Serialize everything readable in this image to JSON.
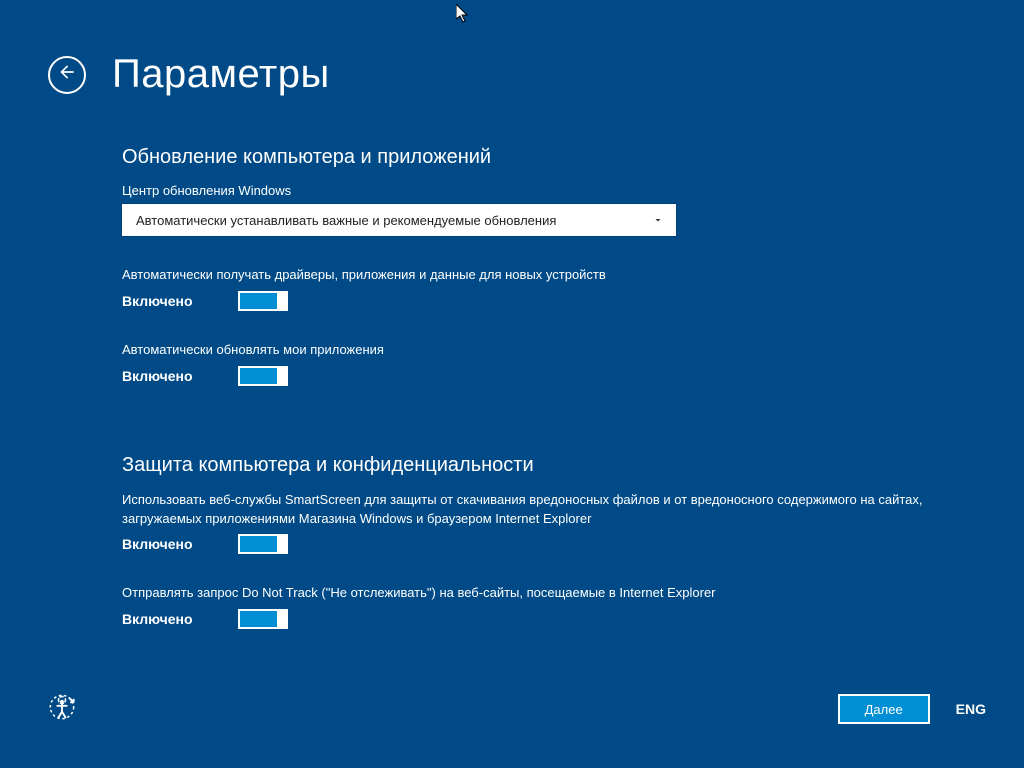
{
  "title": "Параметры",
  "section1": {
    "heading": "Обновление компьютера и приложений",
    "wu_label": "Центр обновления Windows",
    "wu_selected": "Автоматически устанавливать важные и рекомендуемые обновления",
    "opt1_desc": "Автоматически получать драйверы, приложения и данные для новых устройств",
    "opt1_state": "Включено",
    "opt2_desc": "Автоматически обновлять мои приложения",
    "opt2_state": "Включено"
  },
  "section2": {
    "heading": "Защита компьютера и конфиденциальности",
    "opt1_desc": "Использовать веб-службы SmartScreen для защиты от скачивания вредоносных файлов и от вредоносного содержимого на сайтах, загружаемых приложениями Магазина Windows и браузером Internet Explorer",
    "opt1_state": "Включено",
    "opt2_desc": "Отправлять запрос Do Not Track (\"Не отслеживать\") на веб-сайты, посещаемые в Internet Explorer",
    "opt2_state": "Включено"
  },
  "footer": {
    "next": "Далее",
    "lang": "ENG"
  }
}
